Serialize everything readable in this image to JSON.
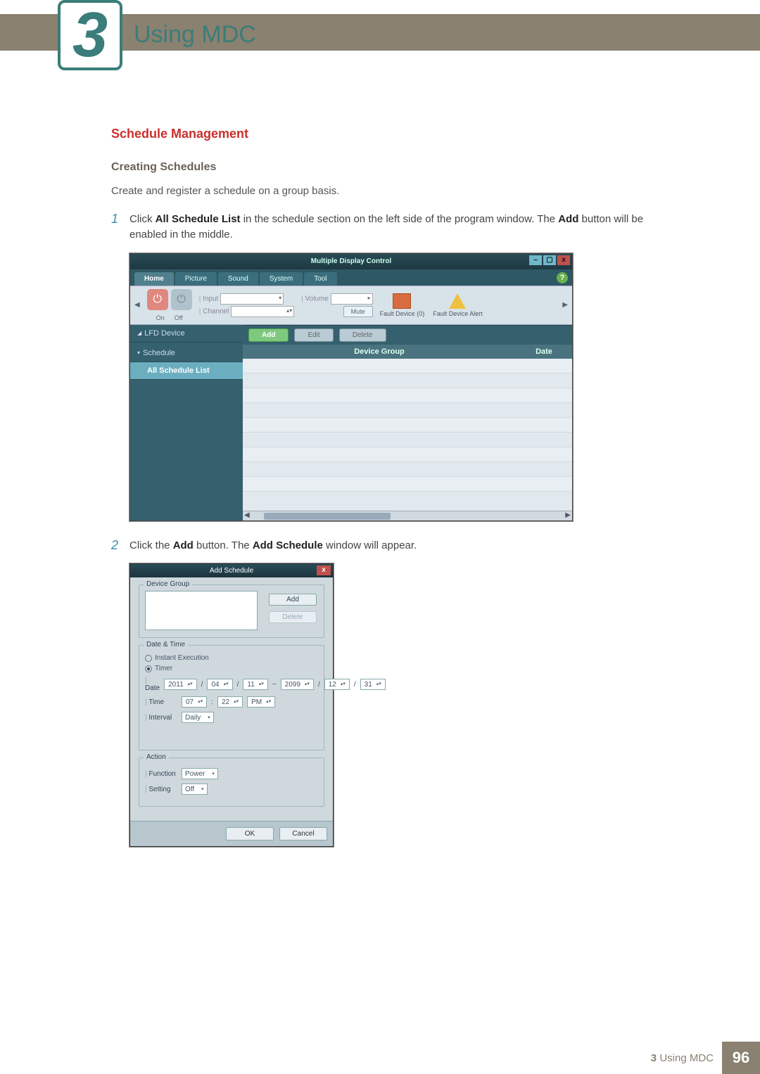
{
  "chapter": {
    "number": "3",
    "title": "Using MDC"
  },
  "section": {
    "title": "Schedule Management"
  },
  "sub": {
    "title": "Creating Schedules"
  },
  "intro": "Create and register a schedule on a group basis.",
  "steps": {
    "s1_num": "1",
    "s1_a": "Click ",
    "s1_b": "All Schedule List",
    "s1_c": " in the schedule section on the left side of the program window. The ",
    "s1_d": "Add",
    "s1_e": " button will be enabled in the middle.",
    "s2_num": "2",
    "s2_a": "Click the ",
    "s2_b": "Add",
    "s2_c": " button. The ",
    "s2_d": "Add Schedule",
    "s2_e": " window will appear."
  },
  "win1": {
    "title": "Multiple Display Control",
    "tabs": {
      "home": "Home",
      "picture": "Picture",
      "sound": "Sound",
      "system": "System",
      "tool": "Tool"
    },
    "help": "?",
    "ribbon": {
      "on": "On",
      "off": "Off",
      "input": "Input",
      "channel": "Channel",
      "volume": "Volume",
      "mute": "Mute",
      "fd0": "Fault Device (0)",
      "fda": "Fault Device Alert"
    },
    "sidebar": {
      "lfd": "LFD Device",
      "schedule": "Schedule",
      "all": "All Schedule List"
    },
    "toolbar": {
      "add": "Add",
      "edit": "Edit",
      "delete": "Delete"
    },
    "cols": {
      "dg": "Device Group",
      "date": "Date"
    }
  },
  "win2": {
    "title": "Add Schedule",
    "dg": "Device Group",
    "add": "Add",
    "delete": "Delete",
    "dt": "Date & Time",
    "instant": "Instant Execution",
    "timer": "Timer",
    "date": "Date",
    "time": "Time",
    "interval": "Interval",
    "d_y1": "2011",
    "d_m1": "04",
    "d_d1": "11",
    "d_tilde": "~",
    "d_y2": "2099",
    "d_m2": "12",
    "d_d2": "31",
    "t_h": "07",
    "t_m": "22",
    "t_ap": "PM",
    "int_v": "Daily",
    "action": "Action",
    "function": "Function",
    "setting": "Setting",
    "fn_v": "Power",
    "st_v": "Off",
    "ok": "OK",
    "cancel": "Cancel"
  },
  "footer": {
    "chapnum": "3",
    "label": "Using MDC",
    "page": "96"
  }
}
